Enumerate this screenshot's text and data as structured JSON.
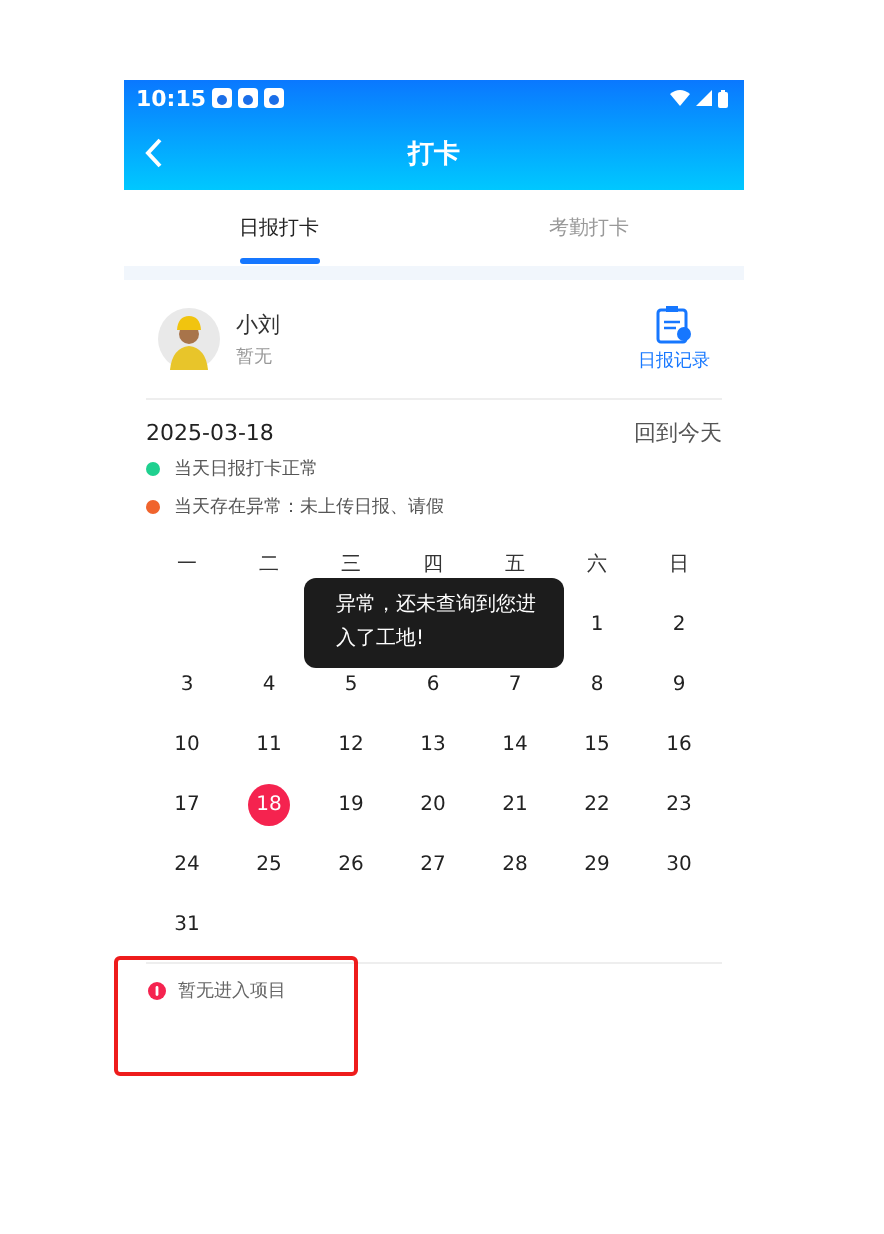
{
  "status_bar": {
    "time": "10:15"
  },
  "header": {
    "title": "打卡"
  },
  "tabs": [
    {
      "label": "日报打卡",
      "selected": true
    },
    {
      "label": "考勤打卡",
      "selected": false
    }
  ],
  "user": {
    "name": "小刘",
    "subtitle": "暂无",
    "action": "日报记录"
  },
  "calendar": {
    "date": "2025-03-18",
    "today_link": "回到今天",
    "legend": [
      {
        "text": "当天日报打卡正常",
        "color": "#1fd08f"
      },
      {
        "text": "当天存在异常：未上传日报、请假",
        "color": "#f0642d"
      }
    ],
    "weekdays": [
      "一",
      "二",
      "三",
      "四",
      "五",
      "六",
      "日"
    ],
    "days": [
      {
        "day": "1",
        "selected": false
      },
      {
        "day": "2",
        "selected": false
      },
      {
        "day": "3",
        "selected": false
      },
      {
        "day": "4",
        "selected": false
      },
      {
        "day": "5",
        "selected": false
      },
      {
        "day": "6",
        "selected": false
      },
      {
        "day": "7",
        "selected": false
      },
      {
        "day": "8",
        "selected": false
      },
      {
        "day": "9",
        "selected": false
      },
      {
        "day": "10",
        "selected": false
      },
      {
        "day": "11",
        "selected": false
      },
      {
        "day": "12",
        "selected": false
      },
      {
        "day": "13",
        "selected": false
      },
      {
        "day": "14",
        "selected": false
      },
      {
        "day": "15",
        "selected": false
      },
      {
        "day": "16",
        "selected": false
      },
      {
        "day": "17",
        "selected": false
      },
      {
        "day": "18",
        "selected": true
      },
      {
        "day": "19",
        "selected": false
      },
      {
        "day": "20",
        "selected": false
      },
      {
        "day": "21",
        "selected": false
      },
      {
        "day": "22",
        "selected": false
      },
      {
        "day": "23",
        "selected": false
      },
      {
        "day": "24",
        "selected": false
      },
      {
        "day": "25",
        "selected": false
      },
      {
        "day": "26",
        "selected": false
      },
      {
        "day": "27",
        "selected": false
      },
      {
        "day": "28",
        "selected": false
      },
      {
        "day": "29",
        "selected": false
      },
      {
        "day": "30",
        "selected": false
      },
      {
        "day": "31",
        "selected": false
      }
    ]
  },
  "notice": {
    "text": "暂无进入项目"
  },
  "toast": {
    "text": "异常，还未查询到您进入了工地!"
  }
}
